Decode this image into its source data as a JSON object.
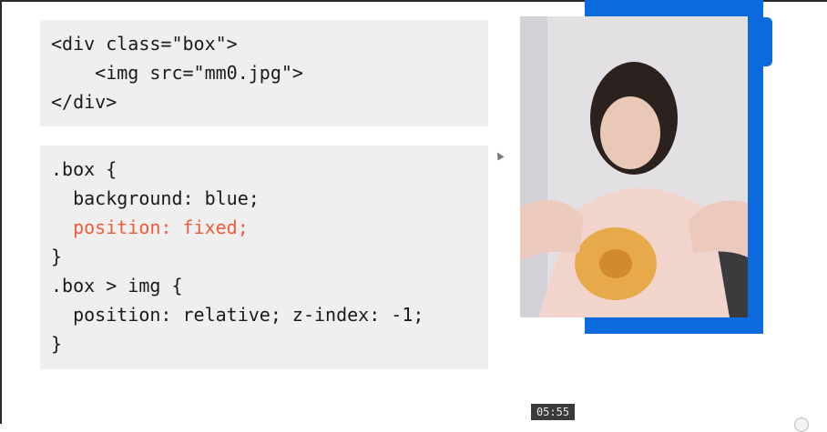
{
  "html_code": {
    "lines": [
      "<div class=\"box\">",
      "    <img src=\"mm0.jpg\">",
      "</div>"
    ]
  },
  "css_code": {
    "lines": [
      ".box {",
      "  background: blue;",
      "  position: fixed;",
      "}",
      ".box > img {",
      "  position: relative; z-index: -1;",
      "}"
    ],
    "highlight_color": "#ef5c3a"
  },
  "demo": {
    "box_color": "#0b6bdc",
    "image_description_icon": "photo-icon"
  },
  "player": {
    "timestamp": "05:55"
  }
}
